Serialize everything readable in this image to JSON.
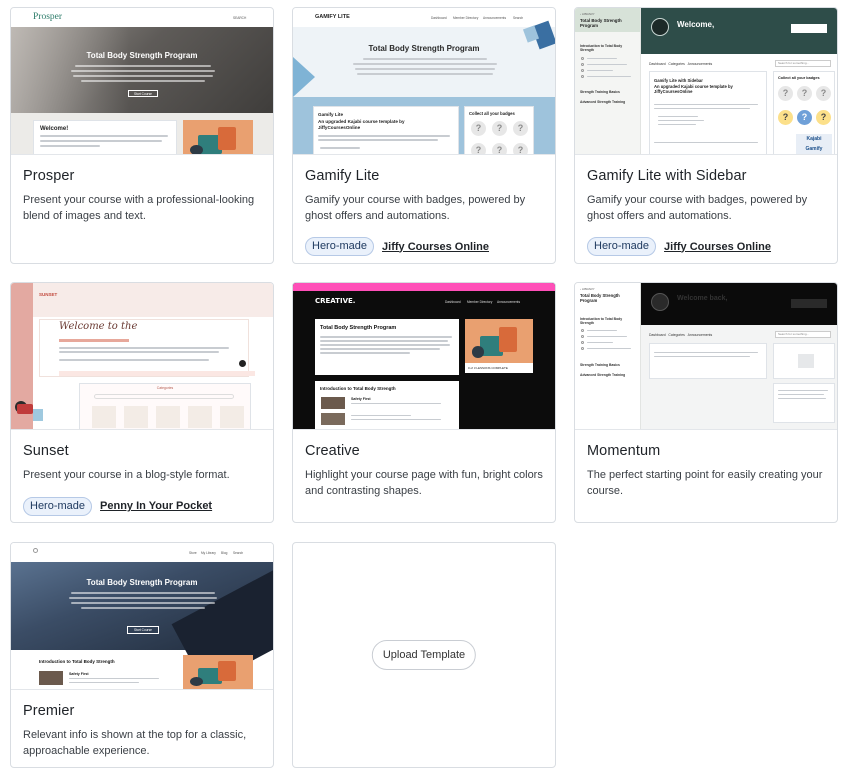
{
  "thumb_text": {
    "program_title": "Total Body Strength Program",
    "welcome": "Welcome!",
    "prosper_logo": "Prosper",
    "gamify_logo": "GAMIFY LITE",
    "gamify_card_title": "Gamify Lite",
    "gamify_card_sub": "An upgraded Kajabi course template by JiffyCoursesOnline",
    "collect_badges": "Collect all your badges",
    "gamify_sidebar_card_title": "Gamify Lite with Sidebar",
    "sidebar_welcome": "Welcome,",
    "intro_section": "Introduction to Total Body Strength",
    "strength_basics": "Strength Training Basics",
    "advanced_training": "Advanced Strength Training",
    "sunset_logo": "SUNSET",
    "sunset_welcome": "Welcome to the",
    "creative_logo": "CREATIVE.",
    "momentum_welcome": "Welcome back,",
    "intro_lesson": "Introduction to Total Body Strength",
    "safety_first": "Safety First"
  },
  "templates": [
    {
      "name": "Prosper",
      "desc": "Present your course with a professional-looking blend of images and text."
    },
    {
      "name": "Gamify Lite",
      "desc": "Gamify your course with badges, powered by ghost offers and automations.",
      "badge": "Hero-made",
      "author": "Jiffy Courses Online"
    },
    {
      "name": "Gamify Lite with Sidebar",
      "desc": "Gamify your course with badges, powered by ghost offers and automations.",
      "badge": "Hero-made",
      "author": "Jiffy Courses Online"
    },
    {
      "name": "Sunset",
      "desc": "Present your course in a blog-style format.",
      "badge": "Hero-made",
      "author": "Penny In Your Pocket"
    },
    {
      "name": "Creative",
      "desc": "Highlight your course page with fun, bright colors and contrasting shapes."
    },
    {
      "name": "Momentum",
      "desc": "The perfect starting point for easily creating your course."
    },
    {
      "name": "Premier",
      "desc": "Relevant info is shown at the top for a classic, approachable experience."
    }
  ],
  "upload": {
    "label": "Upload Template"
  },
  "colors": {
    "hero_badge_bg": "#eaf1fb",
    "hero_badge_border": "#b6c9e6",
    "creative_pink": "#ff4fb8",
    "gamify_blue": "#9ec3dc"
  }
}
